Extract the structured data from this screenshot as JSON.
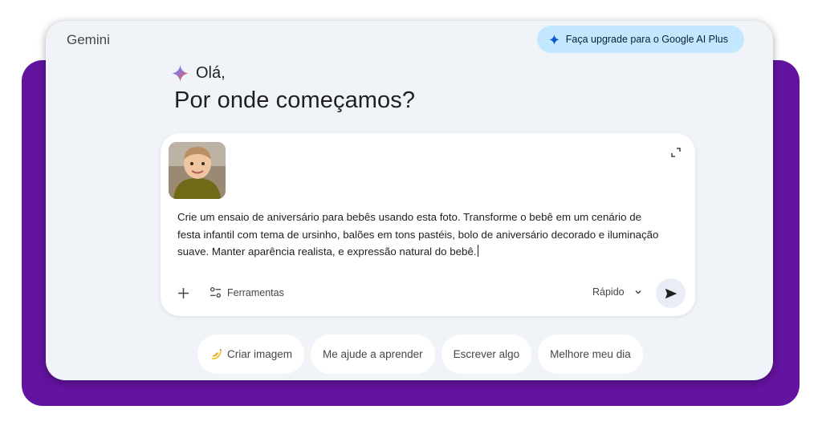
{
  "app": {
    "title": "Gemini",
    "upgrade_label": "Faça upgrade para o Google AI Plus"
  },
  "greeting": {
    "hello": "Olá,",
    "headline": "Por onde começamos?"
  },
  "prompt": {
    "attachment_icon": "baby-photo-thumbnail",
    "text": "Crie um ensaio de aniversário para bebês usando esta foto. Transforme o bebê em um cenário de festa infantil com tema de ursinho, balões em tons pastéis, bolo de aniversário decorado e iluminação suave. Manter aparência realista, e expressão natural do bebê.",
    "tools_label": "Ferramentas",
    "mode_label": "Rápido"
  },
  "chips": [
    {
      "label": "Criar imagem",
      "icon": "banana-icon"
    },
    {
      "label": "Me ajude a aprender"
    },
    {
      "label": "Escrever algo"
    },
    {
      "label": "Melhore meu dia"
    }
  ],
  "colors": {
    "purple_backdrop": "#62139f",
    "window_bg": "#f0f4f9",
    "upgrade_bg": "#c2e7ff"
  }
}
